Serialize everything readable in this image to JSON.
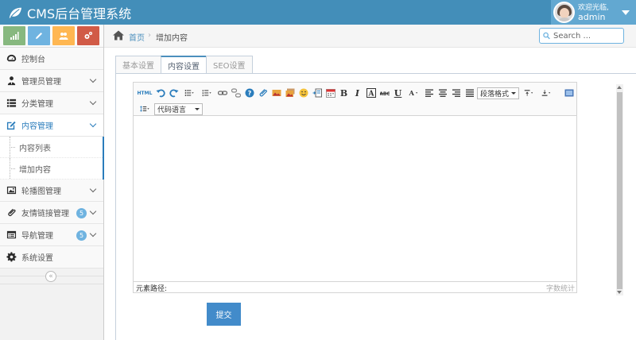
{
  "header": {
    "app_title": "CMS后台管理系统",
    "welcome": "欢迎光临,",
    "username": "admin"
  },
  "sidebar": {
    "shortcuts": [
      {
        "icon": "signal-icon",
        "color": "#87b87f"
      },
      {
        "icon": "pencil-icon",
        "color": "#6fb3e0"
      },
      {
        "icon": "users-icon",
        "color": "#ffb752"
      },
      {
        "icon": "cogs-icon",
        "color": "#d15b47"
      }
    ],
    "items": [
      {
        "label": "控制台",
        "icon": "tachometer-icon"
      },
      {
        "label": "管理员管理",
        "icon": "user-tie-icon"
      },
      {
        "label": "分类管理",
        "icon": "list-icon"
      },
      {
        "label": "内容管理",
        "icon": "edit-icon"
      },
      {
        "label": "轮播图管理",
        "icon": "picture-icon"
      },
      {
        "label": "友情链接管理",
        "icon": "paperclip-icon",
        "badge": "5"
      },
      {
        "label": "导航管理",
        "icon": "navbar-icon",
        "badge": "5"
      },
      {
        "label": "系统设置",
        "icon": "gear-icon"
      }
    ],
    "content_submenu": [
      "内容列表",
      "增加内容"
    ],
    "collapse_glyph": "«"
  },
  "breadcrumb": {
    "home": "首页",
    "separator": "›",
    "current": "增加内容"
  },
  "search": {
    "placeholder": "Search ..."
  },
  "tabs": [
    "基本设置",
    "内容设置",
    "SEO设置"
  ],
  "active_tab": 1,
  "editor": {
    "toolbar": {
      "html_label": "HTML",
      "paragraph_format": "段落格式",
      "code_language": "代码语言"
    },
    "element_path": "元素路径:",
    "word_count": "字数统计"
  },
  "submit_label": "提交",
  "colors": {
    "header_bg": "#438eb9",
    "accent": "#2b7dbc",
    "submit": "#428bca"
  }
}
